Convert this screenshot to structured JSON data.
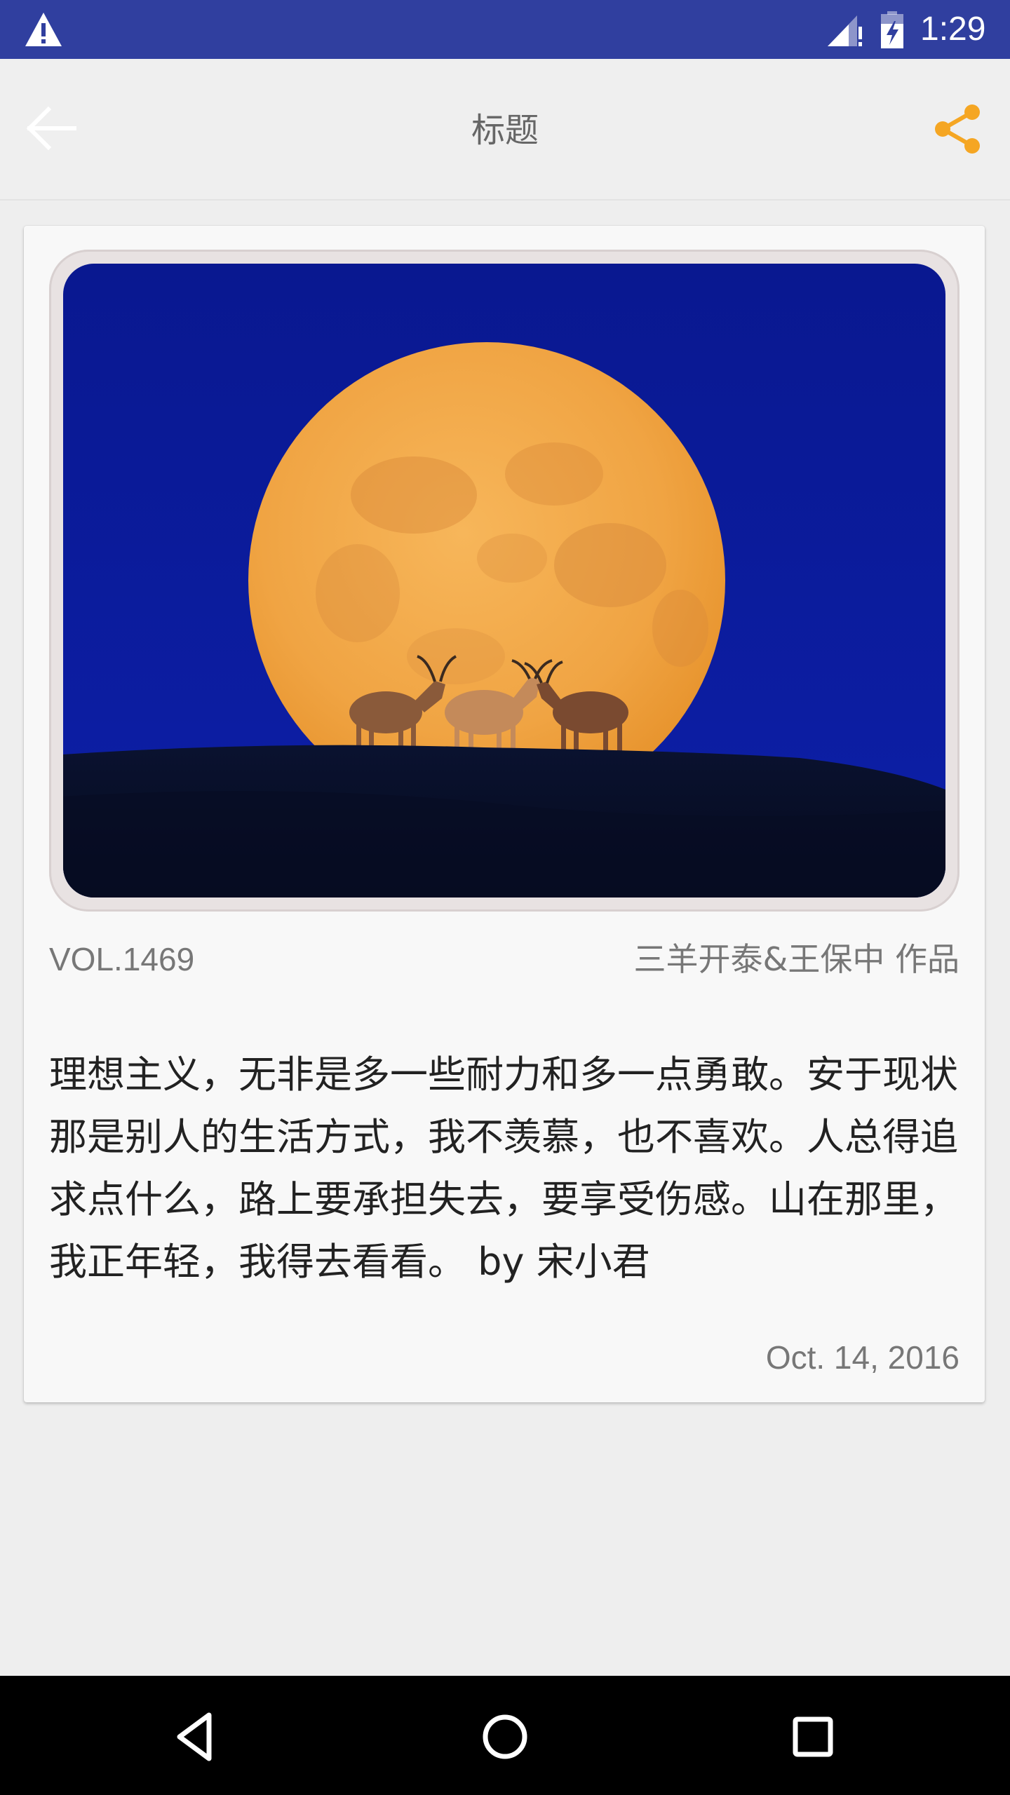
{
  "status_bar": {
    "time": "1:29",
    "icons": [
      "warning-icon",
      "signal-icon",
      "battery-charging-icon"
    ]
  },
  "app_bar": {
    "title": "标题",
    "back_icon": "arrow-back-icon",
    "share_icon": "share-icon",
    "share_color": "#f5a623"
  },
  "card": {
    "image_subject": "full-moon-with-three-goats",
    "vol": "VOL.1469",
    "credit": "三羊开泰&王保中 作品",
    "content": "理想主义，无非是多一些耐力和多一点勇敢。安于现状那是别人的生活方式，我不羡慕，也不喜欢。人总得追求点什么，路上要承担失去，要享受伤感。山在那里，我正年轻，我得去看看。 by 宋小君",
    "date": "Oct. 14,  2016"
  },
  "nav_bar": {
    "icons": [
      "back-triangle-icon",
      "home-circle-icon",
      "recents-square-icon"
    ]
  },
  "colors": {
    "status_bar": "#303f9f",
    "app_bar": "#efefef",
    "background": "#eeeeee",
    "card": "#f8f8f8",
    "sky": "#0a1a9c",
    "moon": "#f2a847"
  }
}
